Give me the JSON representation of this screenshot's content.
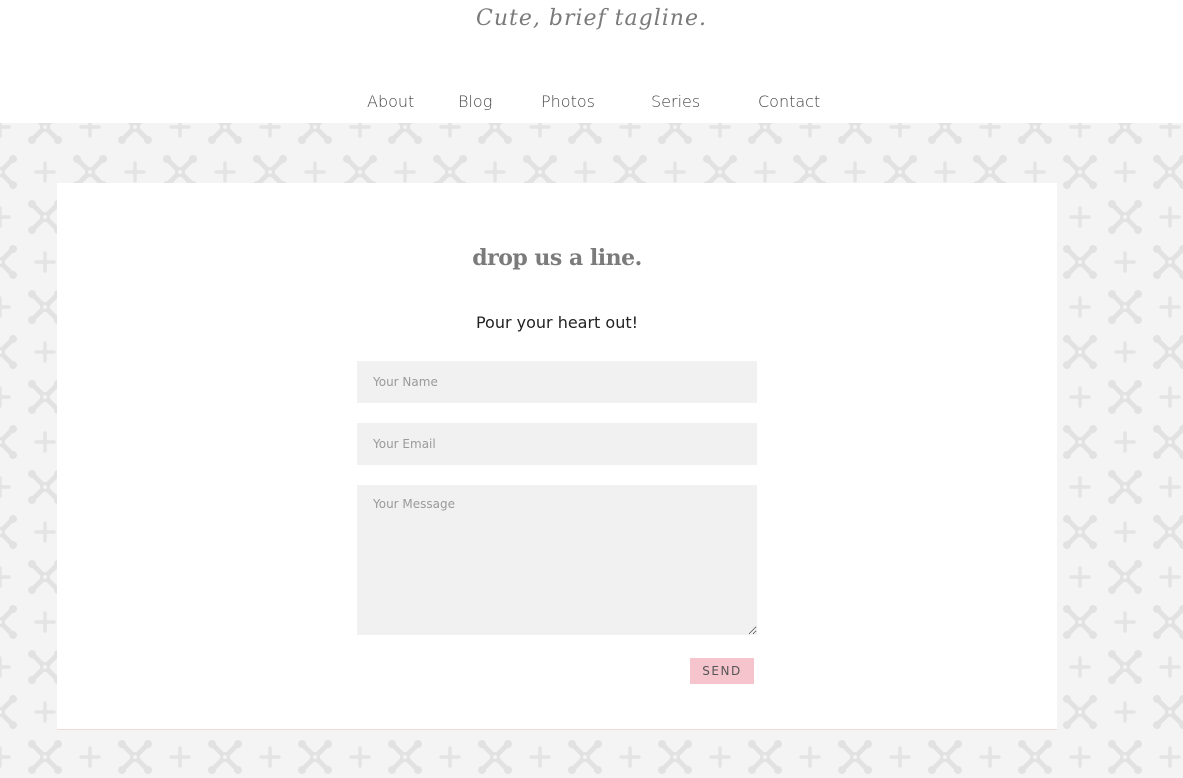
{
  "header": {
    "tagline": "Cute, brief tagline."
  },
  "nav": {
    "items": [
      {
        "label": "About"
      },
      {
        "label": "Blog"
      },
      {
        "label": "Photos"
      },
      {
        "label": "Series"
      },
      {
        "label": "Contact"
      }
    ]
  },
  "contact": {
    "title": "drop us a line.",
    "subtitle": "Pour your heart out!",
    "name_placeholder": "Your Name",
    "email_placeholder": "Your Email",
    "message_placeholder": "Your Message",
    "send_label": "SEND"
  },
  "colors": {
    "send_button": "#f5c4cc",
    "field_background": "#f1f1f1",
    "pattern_background": "#f4f4f4",
    "pattern_motif": "#e2e2e2"
  },
  "icons": {
    "background_motif": "snowflake-cross-pattern"
  }
}
